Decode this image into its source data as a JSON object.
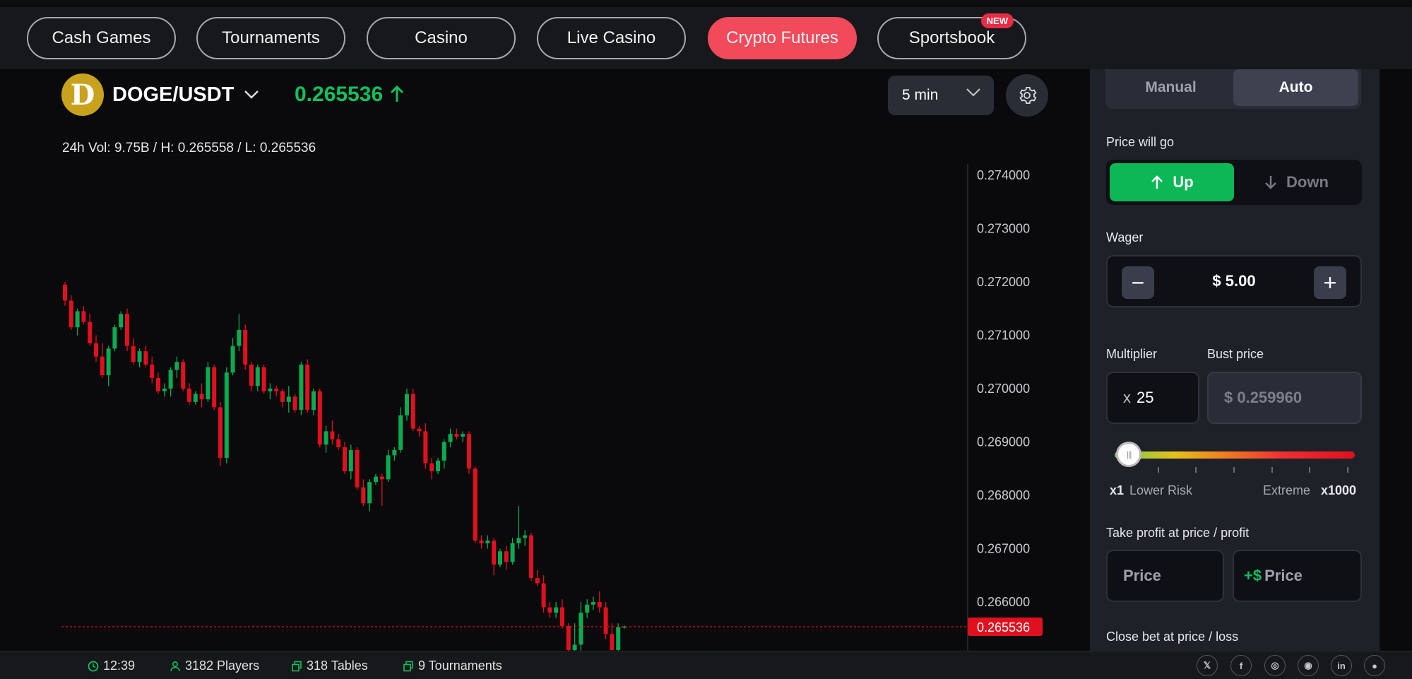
{
  "nav": {
    "tabs": [
      {
        "label": "Cash Games"
      },
      {
        "label": "Tournaments"
      },
      {
        "label": "Casino"
      },
      {
        "label": "Live Casino"
      },
      {
        "label": "Crypto Futures"
      },
      {
        "label": "Sportsbook",
        "badge": "NEW"
      }
    ],
    "active": "Crypto Futures"
  },
  "pair": {
    "coin_letter": "D",
    "name": "DOGE/USDT",
    "price": "0.265536",
    "direction_icon": "arrow-up-icon",
    "stats": "24h Vol: 9.75B / H: 0.265558 / L: 0.265536",
    "interval": "5 min"
  },
  "chart_data": {
    "type": "candlestick",
    "y_ticks": [
      "0.274000",
      "0.273000",
      "0.272000",
      "0.271000",
      "0.270000",
      "0.269000",
      "0.268000",
      "0.267000",
      "0.266000"
    ],
    "ylim": [
      0.2652,
      0.2744
    ],
    "current_price_label": "0.265536",
    "current_price": 0.265536,
    "colors": {
      "up": "#0bab4f",
      "down": "#e0101e",
      "price_line": "#e0101e"
    },
    "candles": [
      [
        0.27195,
        0.272,
        0.27155,
        0.27165
      ],
      [
        0.27165,
        0.27175,
        0.2711,
        0.27115
      ],
      [
        0.27115,
        0.2715,
        0.271,
        0.27145
      ],
      [
        0.27145,
        0.27155,
        0.2712,
        0.27125
      ],
      [
        0.27125,
        0.2714,
        0.2708,
        0.27085
      ],
      [
        0.27085,
        0.271,
        0.2705,
        0.2706
      ],
      [
        0.2706,
        0.27085,
        0.2702,
        0.27025
      ],
      [
        0.27025,
        0.2708,
        0.27005,
        0.27075
      ],
      [
        0.27075,
        0.2712,
        0.2707,
        0.27115
      ],
      [
        0.27115,
        0.27145,
        0.2711,
        0.2714
      ],
      [
        0.2714,
        0.2715,
        0.2707,
        0.2708
      ],
      [
        0.2708,
        0.27095,
        0.27045,
        0.2705
      ],
      [
        0.2705,
        0.27075,
        0.2704,
        0.2707
      ],
      [
        0.2707,
        0.2708,
        0.2704,
        0.27045
      ],
      [
        0.27045,
        0.2706,
        0.2701,
        0.2702
      ],
      [
        0.2702,
        0.2703,
        0.2699,
        0.26995
      ],
      [
        0.26995,
        0.2701,
        0.26985,
        0.27
      ],
      [
        0.27,
        0.2704,
        0.26985,
        0.27035
      ],
      [
        0.27035,
        0.2706,
        0.2702,
        0.2705
      ],
      [
        0.2705,
        0.27055,
        0.26995,
        0.27
      ],
      [
        0.27,
        0.2701,
        0.2697,
        0.26975
      ],
      [
        0.26975,
        0.26995,
        0.2697,
        0.2699
      ],
      [
        0.2699,
        0.2701,
        0.26965,
        0.2698
      ],
      [
        0.2698,
        0.2705,
        0.26975,
        0.2704
      ],
      [
        0.2704,
        0.27045,
        0.2696,
        0.26965
      ],
      [
        0.26965,
        0.26975,
        0.26855,
        0.2687
      ],
      [
        0.2687,
        0.2704,
        0.2686,
        0.2703
      ],
      [
        0.2703,
        0.27095,
        0.27025,
        0.2708
      ],
      [
        0.2708,
        0.2714,
        0.2707,
        0.2711
      ],
      [
        0.2711,
        0.2712,
        0.27035,
        0.27045
      ],
      [
        0.27045,
        0.2705,
        0.26995,
        0.27005
      ],
      [
        0.27005,
        0.27045,
        0.26995,
        0.2704
      ],
      [
        0.2704,
        0.27045,
        0.2699,
        0.26995
      ],
      [
        0.26995,
        0.2701,
        0.2698,
        0.27
      ],
      [
        0.27,
        0.27005,
        0.26985,
        0.26995
      ],
      [
        0.26995,
        0.27,
        0.26965,
        0.26975
      ],
      [
        0.26975,
        0.27005,
        0.26955,
        0.26985
      ],
      [
        0.26985,
        0.2699,
        0.26955,
        0.2696
      ],
      [
        0.2696,
        0.2705,
        0.2695,
        0.27045
      ],
      [
        0.27045,
        0.27055,
        0.26955,
        0.2696
      ],
      [
        0.2696,
        0.27,
        0.2695,
        0.26995
      ],
      [
        0.26995,
        0.27,
        0.2689,
        0.26895
      ],
      [
        0.26895,
        0.2693,
        0.2688,
        0.2692
      ],
      [
        0.2692,
        0.2694,
        0.26895,
        0.26905
      ],
      [
        0.26905,
        0.26915,
        0.26885,
        0.2689
      ],
      [
        0.2689,
        0.269,
        0.2684,
        0.26845
      ],
      [
        0.26845,
        0.26895,
        0.2683,
        0.26885
      ],
      [
        0.26885,
        0.2689,
        0.2681,
        0.26815
      ],
      [
        0.26815,
        0.2683,
        0.2678,
        0.26785
      ],
      [
        0.26785,
        0.2683,
        0.2677,
        0.26825
      ],
      [
        0.26825,
        0.2684,
        0.2682,
        0.26835
      ],
      [
        0.26835,
        0.2684,
        0.2678,
        0.2683
      ],
      [
        0.2683,
        0.26885,
        0.26825,
        0.26875
      ],
      [
        0.26875,
        0.2689,
        0.26865,
        0.26885
      ],
      [
        0.26885,
        0.26965,
        0.2688,
        0.2695
      ],
      [
        0.2695,
        0.27,
        0.2694,
        0.2699
      ],
      [
        0.2699,
        0.27,
        0.2692,
        0.26925
      ],
      [
        0.26925,
        0.2693,
        0.2691,
        0.2692
      ],
      [
        0.2692,
        0.26935,
        0.2685,
        0.2686
      ],
      [
        0.2686,
        0.2687,
        0.2683,
        0.26845
      ],
      [
        0.26845,
        0.2687,
        0.2684,
        0.26865
      ],
      [
        0.26865,
        0.26905,
        0.2685,
        0.269
      ],
      [
        0.269,
        0.26925,
        0.2689,
        0.26915
      ],
      [
        0.26915,
        0.26925,
        0.26905,
        0.2691
      ],
      [
        0.2691,
        0.2692,
        0.269,
        0.26915
      ],
      [
        0.26915,
        0.2692,
        0.2684,
        0.2685
      ],
      [
        0.2685,
        0.26855,
        0.2671,
        0.26715
      ],
      [
        0.26715,
        0.26725,
        0.267,
        0.2671
      ],
      [
        0.2671,
        0.26725,
        0.267,
        0.26715
      ],
      [
        0.26715,
        0.2672,
        0.2665,
        0.2667
      ],
      [
        0.2667,
        0.267,
        0.26665,
        0.26695
      ],
      [
        0.26695,
        0.26705,
        0.2666,
        0.26675
      ],
      [
        0.26675,
        0.2672,
        0.2667,
        0.2671
      ],
      [
        0.2671,
        0.2678,
        0.267,
        0.2672
      ],
      [
        0.2672,
        0.26735,
        0.26705,
        0.26725
      ],
      [
        0.26725,
        0.2673,
        0.2664,
        0.26645
      ],
      [
        0.26645,
        0.2666,
        0.2663,
        0.26635
      ],
      [
        0.26635,
        0.2665,
        0.2658,
        0.2659
      ],
      [
        0.2659,
        0.266,
        0.2657,
        0.2658
      ],
      [
        0.2658,
        0.266,
        0.2657,
        0.2659
      ],
      [
        0.2659,
        0.26605,
        0.2655,
        0.26555
      ],
      [
        0.26555,
        0.2656,
        0.265,
        0.2651
      ],
      [
        0.2651,
        0.2656,
        0.265,
        0.2652
      ],
      [
        0.2652,
        0.266,
        0.265,
        0.2658
      ],
      [
        0.2658,
        0.26605,
        0.2657,
        0.26595
      ],
      [
        0.26595,
        0.2661,
        0.26585,
        0.266
      ],
      [
        0.266,
        0.2662,
        0.2658,
        0.2659
      ],
      [
        0.2659,
        0.266,
        0.2653,
        0.2654
      ],
      [
        0.2654,
        0.2656,
        0.265,
        0.2651
      ],
      [
        0.2651,
        0.2656,
        0.265,
        0.26553
      ],
      [
        0.26553,
        0.26556,
        0.2655,
        0.26554
      ]
    ]
  },
  "panel": {
    "mode_manual": "Manual",
    "mode_auto": "Auto",
    "price_will_go": "Price will go",
    "up": "Up",
    "down": "Down",
    "wager_label": "Wager",
    "wager_value": "$ 5.00",
    "multiplier_label": "Multiplier",
    "multiplier_prefix": "x",
    "multiplier_value": "25",
    "bust_label": "Bust price",
    "bust_value": "$ 0.259960",
    "risk_min_x": "x1",
    "risk_min_label": "Lower Risk",
    "risk_max_label": "Extreme",
    "risk_max_x": "x1000",
    "multiplier_level": 0.024,
    "take_profit_label": "Take profit at price / profit",
    "tp_price_placeholder": "Price",
    "tp_profit_prefix": "+$",
    "tp_profit_placeholder": "Price",
    "close_bet_label": "Close bet at price / loss"
  },
  "footer": {
    "time": "12:39",
    "players": "3182 Players",
    "tables": "318 Tables",
    "tournaments": "9 Tournaments",
    "social_icons": [
      "x-icon",
      "facebook-icon",
      "instagram-icon",
      "discord-icon",
      "linkedin-icon",
      "reddit-icon"
    ],
    "social_glyphs": [
      "𝕏",
      "f",
      "◎",
      "◉",
      "in",
      "●"
    ]
  }
}
